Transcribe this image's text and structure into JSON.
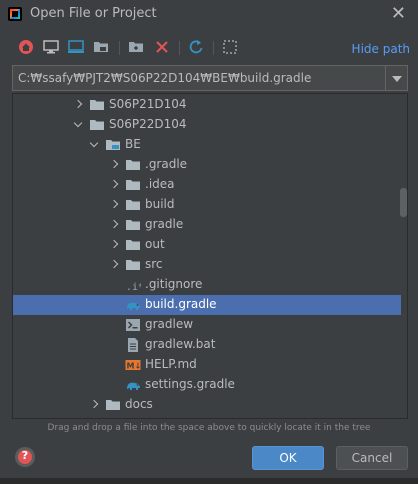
{
  "window": {
    "title": "Open File or Project",
    "close_glyph": "✕"
  },
  "toolbar": {
    "buttons": [
      {
        "name": "home-icon",
        "color": "#e05555"
      },
      {
        "name": "desktop-icon",
        "color": "#bbbbbb"
      },
      {
        "name": "project-directory-icon",
        "color": "#3592c4"
      },
      {
        "name": "module-directory-icon",
        "color": "#9aa7b0"
      },
      {
        "name": "new-folder-icon",
        "color": "#9aa7b0"
      },
      {
        "name": "delete-icon",
        "color": "#e05555"
      },
      {
        "name": "refresh-icon",
        "color": "#3592c4"
      },
      {
        "name": "select-all-icon",
        "color": "#9aa7b0"
      }
    ],
    "hide_path_label": "Hide path"
  },
  "path": {
    "value": "C:₩ssafy₩PJT2₩S06P22D104₩BE₩build.gradle"
  },
  "tree": {
    "rows": [
      {
        "label": "S06P21D104",
        "icon": "folder-icon",
        "expand": "collapsed",
        "depth": 2
      },
      {
        "label": "S06P22D104",
        "icon": "folder-icon",
        "expand": "expanded",
        "depth": 2
      },
      {
        "label": "BE",
        "icon": "module-folder-icon",
        "expand": "expanded",
        "depth": 3
      },
      {
        "label": ".gradle",
        "icon": "folder-icon",
        "expand": "collapsed",
        "depth": 4
      },
      {
        "label": ".idea",
        "icon": "folder-icon",
        "expand": "collapsed",
        "depth": 4
      },
      {
        "label": "build",
        "icon": "folder-icon",
        "expand": "collapsed",
        "depth": 4
      },
      {
        "label": "gradle",
        "icon": "folder-icon",
        "expand": "collapsed",
        "depth": 4
      },
      {
        "label": "out",
        "icon": "folder-icon",
        "expand": "collapsed",
        "depth": 4
      },
      {
        "label": "src",
        "icon": "folder-icon",
        "expand": "collapsed",
        "depth": 4
      },
      {
        "label": ".gitignore",
        "icon": "gitignore-icon",
        "expand": "none",
        "depth": 4
      },
      {
        "label": "build.gradle",
        "icon": "gradle-elephant-icon",
        "expand": "none",
        "depth": 4,
        "selected": true
      },
      {
        "label": "gradlew",
        "icon": "shell-script-icon",
        "expand": "none",
        "depth": 4
      },
      {
        "label": "gradlew.bat",
        "icon": "text-file-icon",
        "expand": "none",
        "depth": 4
      },
      {
        "label": "HELP.md",
        "icon": "markdown-icon",
        "expand": "none",
        "depth": 4
      },
      {
        "label": "settings.gradle",
        "icon": "gradle-elephant-icon",
        "expand": "none",
        "depth": 4
      },
      {
        "label": "docs",
        "icon": "folder-icon",
        "expand": "collapsed",
        "depth": 3
      }
    ]
  },
  "hint": "Drag and drop a file into the space above to quickly locate it in the tree",
  "buttons": {
    "help_glyph": "?",
    "ok_label": "OK",
    "cancel_label": "Cancel"
  },
  "colors": {
    "background": "#3c3f41",
    "selection": "#4b6eaf",
    "link": "#589df6",
    "folder": "#aeb9c0",
    "primary_button": "#4a88c7"
  }
}
